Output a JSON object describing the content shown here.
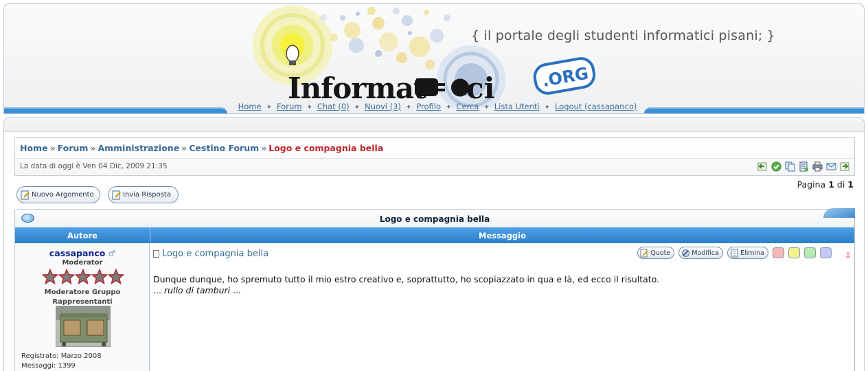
{
  "header": {
    "tagline": "{ il portale degli studenti informatici pisani; }",
    "logo_text": "Informat",
    "logo_org": ".ORG",
    "logo_ci": "ci"
  },
  "nav": {
    "items": [
      {
        "label": "Home"
      },
      {
        "label": "Forum"
      },
      {
        "label": "Chat (0)"
      },
      {
        "label": "Nuovi (3)"
      },
      {
        "label": "Profilo"
      },
      {
        "label": "Cerca"
      },
      {
        "label": "Lista Utenti"
      },
      {
        "label": "Logout (cassapanco)"
      }
    ],
    "separator": "✦"
  },
  "breadcrumb": {
    "items": [
      "Home",
      "Forum",
      "Amministrazione",
      "Cestino Forum"
    ],
    "current": "Logo e compagnia bella",
    "sep": "»"
  },
  "date_line": "La data di oggi è Ven 04 Dic, 2009 21:35",
  "toolbar_icons": [
    "back-icon",
    "check-icon",
    "copy-icon",
    "move-icon",
    "print-icon",
    "email-icon",
    "next-icon"
  ],
  "pagination": {
    "prefix": "Pagina",
    "current": "1",
    "of": "di",
    "total": "1"
  },
  "buttons": {
    "new_topic": "Nuovo Argomento",
    "reply": "Invia Risposta"
  },
  "topic": {
    "title": "Logo e compagnia bella",
    "col_author": "Autore",
    "col_message": "Messaggio"
  },
  "post": {
    "author": "cassapanco",
    "role": "Moderator",
    "group_line1": "Moderatore Gruppo",
    "group_line2": "Rappresentanti",
    "stars": 5,
    "registered": "Registrato: Marzo 2008",
    "messages": "Messaggi: 1399",
    "title": "Logo e compagnia bella",
    "actions": {
      "quote": "Quote",
      "edit": "Modifica",
      "delete": "Elimina"
    },
    "colors": [
      "#f6b7b7",
      "#f4f38f",
      "#b4ebb0",
      "#c6c6f3"
    ],
    "body_line1": "Dunque dunque, ho spremuto tutto il mio estro creativo e, soprattutto, ho scopiazzato in qua e là, ed ecco il risultato.",
    "body_line2_prefix": "...",
    "body_line2_italic": "rullo di tamburi",
    "body_line2_suffix": "..."
  }
}
